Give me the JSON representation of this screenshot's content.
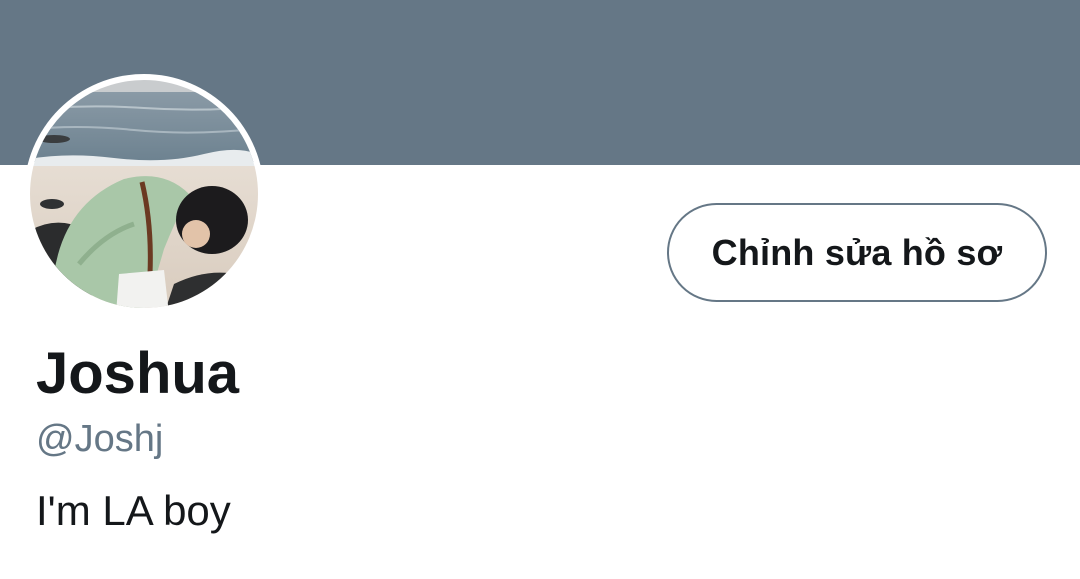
{
  "profile": {
    "display_name": "Joshua",
    "handle": "@Joshj",
    "bio": "I'm LA boy",
    "edit_button_label": "Chỉnh sửa hồ sơ"
  },
  "colors": {
    "banner": "#657786",
    "text_primary": "#14171a",
    "text_secondary": "#657786",
    "button_border": "#657786",
    "background": "#ffffff"
  },
  "icons": {
    "avatar": "profile-photo"
  }
}
